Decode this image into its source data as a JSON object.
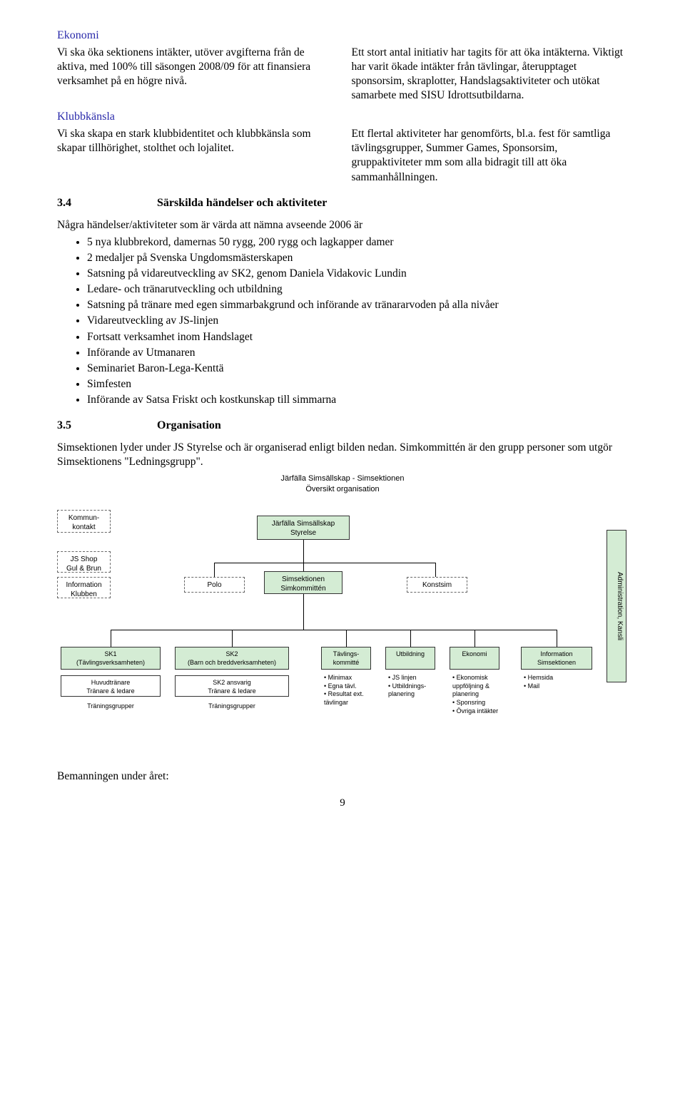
{
  "section1": {
    "title": "Ekonomi",
    "leftText": "Vi ska öka sektionens intäkter, utöver avgifterna från de aktiva, med 100% till säsongen 2008/09 för att finansiera verksamhet på en högre nivå.",
    "rightText": "Ett stort antal initiativ har tagits för att öka intäkterna. Viktigt har varit ökade intäkter från tävlingar, återupptaget sponsorsim, skraplotter, Handslagsaktiviteter och utökat samarbete med SISU Idrottsutbildarna."
  },
  "section2": {
    "title": "Klubbkänsla",
    "leftText": "Vi ska skapa en stark klubbidentitet och klubbkänsla som skapar tillhörighet, stolthet och lojalitet.",
    "rightText": "Ett flertal aktiviteter har genomförts, bl.a. fest för samtliga tävlingsgrupper, Summer Games, Sponsorsim, gruppaktiviteter mm som alla bidragit till att öka sammanhållningen."
  },
  "sec34": {
    "num": "3.4",
    "title": "Särskilda händelser och aktiviteter",
    "intro": "Några händelser/aktiviteter som är värda att nämna avseende 2006 är",
    "items": [
      "5 nya klubbrekord, damernas 50 rygg, 200 rygg och lagkapper damer",
      "2 medaljer på Svenska Ungdomsmästerskapen",
      "Satsning på vidareutveckling av SK2, genom Daniela Vidakovic Lundin",
      "Ledare- och tränarutveckling och utbildning",
      "Satsning på tränare med egen simmarbakgrund och införande av tränararvoden på alla nivåer",
      "Vidareutveckling av JS-linjen",
      "Fortsatt verksamhet inom Handslaget",
      "Införande av Utmanaren",
      "Seminariet Baron-Lega-Kenttä",
      "Simfesten",
      "Införande av Satsa Friskt och kostkunskap till simmarna"
    ]
  },
  "sec35": {
    "num": "3.5",
    "title": "Organisation",
    "p1": "Simsektionen lyder under JS Styrelse och är organiserad enligt bilden nedan. Simkommittén är den grupp personer som utgör Simsektionens \"Ledningsgrupp\".",
    "chartTitle1": "Järfälla Simsällskap - Simsektionen",
    "chartTitle2": "Översikt organisation"
  },
  "org": {
    "kommun": "Kommun-\nkontakt",
    "styrelse": "Järfälla Simsällskap\nStyrelse",
    "jsshop": "JS Shop\nGul & Brun",
    "info": "Information\nKlubben",
    "polo": "Polo",
    "simkom": "Simsektionen\nSimkommittén",
    "konstsim": "Konstsim",
    "sk1": "SK1\n(Tävlingsverksamheten)",
    "sk1_sub": "Huvudtränare\nTränare & ledare",
    "sk1_tr": "Träningsgrupper",
    "sk2": "SK2\n(Barn och breddverksamheten)",
    "sk2_sub": "SK2 ansvarig\nTränare & ledare",
    "sk2_tr": "Träningsgrupper",
    "tavl": "Tävlings-\nkommitté",
    "tavl_b": [
      "Minimax",
      "Egna tävl.",
      "Resultat ext. tävlingar"
    ],
    "utb": "Utbildning",
    "utb_b": [
      "JS linjen",
      "Utbildnings-planering"
    ],
    "ekon": "Ekonomi",
    "ekon_b": [
      "Ekonomisk uppföljning & planering",
      "Sponsring",
      "Övriga intäkter"
    ],
    "infosim": "Information\nSimsektionen",
    "infosim_b": [
      "Hemsida",
      "Mail"
    ],
    "admin": "Administration, Kansli"
  },
  "footer": {
    "bemanning": "Bemanningen under året:",
    "pageNum": "9"
  }
}
